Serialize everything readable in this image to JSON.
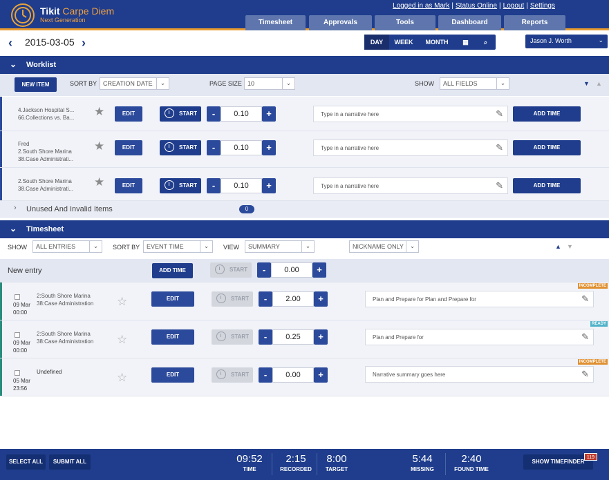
{
  "brand": {
    "name": "Tikit",
    "tagline": "Carpe Diem",
    "sub": "Next Generation"
  },
  "toplinks": [
    "Logged in as Mark",
    "Status Online",
    "Logout",
    "Settings"
  ],
  "tabs": [
    "Timesheet",
    "Approvals",
    "Tools",
    "Dashboard",
    "Reports"
  ],
  "date": "2015-03-05",
  "views": [
    "DAY",
    "WEEK",
    "MONTH"
  ],
  "user": "Jason J. Worth",
  "worklist": {
    "title": "Worklist",
    "new_item": "NEW ITEM",
    "sort_by_label": "SORT BY",
    "sort_by_value": "CREATION DATE",
    "page_size_label": "PAGE SIZE",
    "page_size_value": "10",
    "show_label": "SHOW",
    "show_value": "ALL FIELDS",
    "items": [
      {
        "line1": "4.Jackson Hospital S...",
        "line2": "66.Collections vs. Ba...",
        "line3": "",
        "value": "0.10",
        "placeholder": "Type in a narrative here"
      },
      {
        "line1": "Fred",
        "line2": "2.South Shore Marina",
        "line3": "38.Case Administrati...",
        "value": "0.10",
        "placeholder": "Type in a narrative here"
      },
      {
        "line1": "2.South Shore Marina",
        "line2": "38.Case Administrati...",
        "line3": "",
        "value": "0.10",
        "placeholder": "Type in a narrative here"
      }
    ],
    "edit": "EDIT",
    "start": "START",
    "add_time": "ADD TIME",
    "unused": "Unused And Invalid Items",
    "unused_count": "0"
  },
  "timesheet": {
    "title": "Timesheet",
    "show_label": "SHOW",
    "show_value": "ALL ENTRIES",
    "sort_label": "SORT BY",
    "sort_value": "EVENT TIME",
    "view_label": "VIEW",
    "view_value": "SUMMARY",
    "nickname": "NICKNAME ONLY",
    "new_entry": "New entry",
    "new_entry_value": "0.00",
    "entries": [
      {
        "date": "09 Mar",
        "time": "00:00",
        "line1": "2:South Shore Marina",
        "line2": "38:Case Administration",
        "value": "2.00",
        "narrative": "Plan and Prepare for  Plan and Prepare for",
        "status": "INCOMPLETE"
      },
      {
        "date": "09 Mar",
        "time": "00:00",
        "line1": "2:South Shore Marina",
        "line2": "38:Case Administration",
        "value": "0.25",
        "narrative": "Plan and Prepare for",
        "status": "READY"
      },
      {
        "date": "05 Mar",
        "time": "23:56",
        "line1": "Undefined",
        "line2": "",
        "value": "0.00",
        "narrative": "Narrative summary goes here",
        "status": "INCOMPLETE"
      }
    ]
  },
  "footer": {
    "select_all": "SELECT ALL",
    "submit_all": "SUBMIT ALL",
    "stats": [
      {
        "value": "09:52",
        "label": "TIME"
      },
      {
        "value": "2:15",
        "label": "RECORDED"
      },
      {
        "value": "8:00",
        "label": "TARGET"
      },
      {
        "value": "5:44",
        "label": "MISSING"
      },
      {
        "value": "2:40",
        "label": "FOUND TIME"
      }
    ],
    "show_timefinder": "SHOW TIMEFINDER",
    "timefinder_count": "119"
  }
}
